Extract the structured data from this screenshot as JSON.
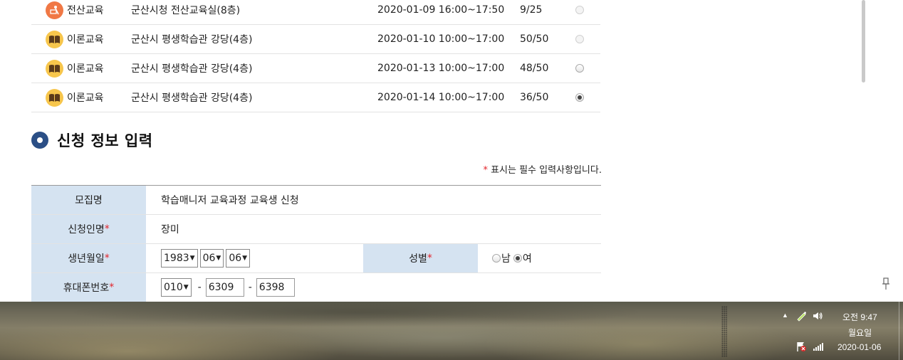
{
  "sessions": [
    {
      "type": "전산교육",
      "icon": "computer-practice-icon",
      "place": "군산시청 전산교육실(8층)",
      "time": "2020-01-09 16:00~17:50",
      "count": "9/25",
      "state": "disabled"
    },
    {
      "type": "이론교육",
      "icon": "book-icon",
      "place": "군산시 평생학습관 강당(4층)",
      "time": "2020-01-10 10:00~17:00",
      "count": "50/50",
      "state": "disabled"
    },
    {
      "type": "이론교육",
      "icon": "book-icon",
      "place": "군산시 평생학습관 강당(4층)",
      "time": "2020-01-13 10:00~17:00",
      "count": "48/50",
      "state": "enabled"
    },
    {
      "type": "이론교육",
      "icon": "book-icon",
      "place": "군산시 평생학습관 강당(4층)",
      "time": "2020-01-14 10:00~17:00",
      "count": "36/50",
      "state": "checked"
    }
  ],
  "section": {
    "title": "신청 정보 입력"
  },
  "required_note": {
    "star": "*",
    "text": " 표시는 필수 입력사항입니다."
  },
  "form": {
    "recruit_label": "모집명",
    "recruit_value": "학습매니저 교육과정 교육생 신청",
    "applicant_label": "신청인명",
    "applicant_value": "장미",
    "birth_label": "생년월일",
    "birth_year": "1983",
    "birth_month": "06",
    "birth_day": "06",
    "gender_label": "성별",
    "gender_male": "남",
    "gender_female": "여",
    "gender_selected": "여",
    "phone_label": "휴대폰번호",
    "phone_prefix": "010",
    "phone_mid": "6309",
    "phone_last": "6398",
    "dash": "-",
    "required_star": "*"
  },
  "taskbar": {
    "clock_time": "오전 9:47",
    "clock_day": "월요일",
    "clock_date": "2020-01-06"
  },
  "colors": {
    "form_header_bg": "#d5e3f1",
    "section_bullet": "#2b4f86",
    "required_star": "#e2232a",
    "practice_icon_bg": "#f07845",
    "theory_icon_bg": "#f7c64c"
  }
}
